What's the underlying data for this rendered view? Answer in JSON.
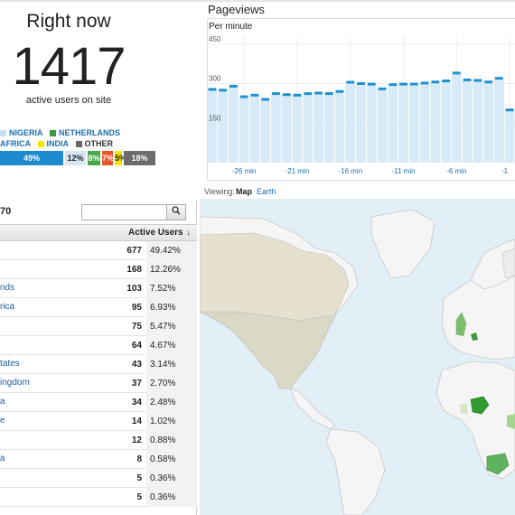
{
  "realtime": {
    "title": "Right now",
    "count": "1417",
    "subtitle": "active users on site"
  },
  "legend": {
    "row1": [
      {
        "label": "NIGERIA",
        "color": "#c9dff0",
        "text_color": "#1a6fb5"
      },
      {
        "label": "NETHERLANDS",
        "color": "#3c9a3c",
        "text_color": "#1a6fb5"
      }
    ],
    "row2": [
      {
        "label": "AFRICA",
        "color": "#1a6fb5",
        "text_color": "#1a6fb5"
      },
      {
        "label": "INDIA",
        "color": "#f2e600",
        "text_color": "#1a6fb5"
      },
      {
        "label": "OTHER",
        "color": "#666666",
        "text_color": "#333333"
      }
    ]
  },
  "share_bar": [
    {
      "label": "49%",
      "color": "#1e8bd0",
      "text_color": "#ffffff",
      "share": 0.49
    },
    {
      "label": "12%",
      "color": "#d9e6f2",
      "text_color": "#222222",
      "share": 0.12
    },
    {
      "label": "8%",
      "color": "#4aa64a",
      "text_color": "#ffffff",
      "share": 0.08
    },
    {
      "label": "7%",
      "color": "#e8552a",
      "text_color": "#ffffff",
      "share": 0.07
    },
    {
      "label": "5%",
      "color": "#f5e400",
      "text_color": "#222222",
      "share": 0.05
    },
    {
      "label": "18%",
      "color": "#6b6b6b",
      "text_color": "#ffffff",
      "share": 0.18
    }
  ],
  "pageviews": {
    "title": "Pageviews",
    "subtitle": "Per minute"
  },
  "chart_data": {
    "type": "bar",
    "title": "Pageviews",
    "subtitle": "Per minute",
    "ylim": [
      0,
      480
    ],
    "yticks": [
      "450",
      "300",
      "150"
    ],
    "ytick_values": [
      450,
      300,
      150
    ],
    "xticks": [
      "-26 min",
      "-21 min",
      "-16 min",
      "-11 min",
      "-6 min",
      "-1"
    ],
    "xtick_values": [
      -26,
      -21,
      -16,
      -11,
      -6,
      -1
    ],
    "x": [
      -29,
      -28,
      -27,
      -26,
      -25,
      -24,
      -23,
      -22,
      -21,
      -20,
      -19,
      -18,
      -17,
      -16,
      -15,
      -14,
      -13,
      -12,
      -11,
      -10,
      -9,
      -8,
      -7,
      -6,
      -5,
      -4,
      -3,
      -2,
      -1
    ],
    "values": [
      278,
      275,
      290,
      250,
      256,
      240,
      262,
      258,
      256,
      262,
      264,
      262,
      270,
      305,
      300,
      298,
      280,
      296,
      298,
      298,
      302,
      306,
      310,
      340,
      314,
      312,
      306,
      320,
      200
    ],
    "color": "#1e90d0",
    "fill": "#d6ebf7"
  },
  "table": {
    "rows_count": "70",
    "search_icon": "magnifier-icon",
    "header_active": "Active Users",
    "sort_icon": "arrow-down-icon",
    "rows": [
      {
        "country": "",
        "count": "677",
        "pct": "49.42%"
      },
      {
        "country": "",
        "count": "168",
        "pct": "12.26%"
      },
      {
        "country": "nds",
        "count": "103",
        "pct": "7.52%"
      },
      {
        "country": "rica",
        "count": "95",
        "pct": "6.93%"
      },
      {
        "country": "",
        "count": "75",
        "pct": "5.47%"
      },
      {
        "country": "",
        "count": "64",
        "pct": "4.67%"
      },
      {
        "country": "tates",
        "count": "43",
        "pct": "3.14%"
      },
      {
        "country": "ingdom",
        "count": "37",
        "pct": "2.70%"
      },
      {
        "country": "a",
        "count": "34",
        "pct": "2.48%"
      },
      {
        "country": "e",
        "count": "14",
        "pct": "1.02%"
      },
      {
        "country": "",
        "count": "12",
        "pct": "0.88%"
      },
      {
        "country": "a",
        "count": "8",
        "pct": "0.58%"
      },
      {
        "country": "",
        "count": "5",
        "pct": "0.36%"
      },
      {
        "country": "",
        "count": "5",
        "pct": "0.36%"
      }
    ]
  },
  "map": {
    "viewing_label": "Viewing:",
    "tab_map": "Map",
    "tab_earth": "Earth",
    "ocean_color": "#e3eff6",
    "land_color": "#f5f5f5",
    "highlight_color": "#5fb35f",
    "strong_highlight": "#2f9a2f"
  }
}
